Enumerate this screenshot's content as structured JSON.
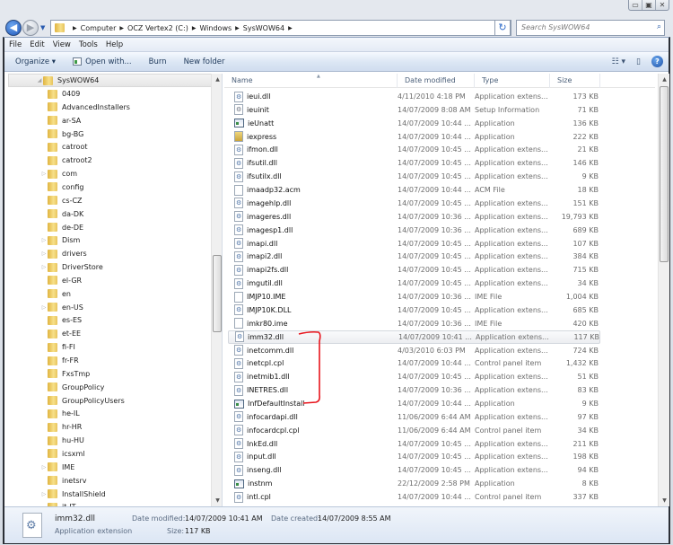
{
  "window_controls": {
    "minimize": "▭",
    "maximize": "▣",
    "close": "✕"
  },
  "address": {
    "crumbs": [
      "Computer",
      "OCZ Vertex2 (C:)",
      "Windows",
      "SysWOW64"
    ],
    "search_placeholder": "Search SysWOW64"
  },
  "menu": [
    "File",
    "Edit",
    "View",
    "Tools",
    "Help"
  ],
  "toolbar": {
    "organize": "Organize ▾",
    "open_with": "Open with...",
    "burn": "Burn",
    "new_folder": "New folder",
    "views": "☷ ▾",
    "preview": "▯",
    "help": "?"
  },
  "tree": {
    "selected": "SysWOW64",
    "items": [
      {
        "label": "0409",
        "exp": false
      },
      {
        "label": "AdvancedInstallers",
        "exp": false
      },
      {
        "label": "ar-SA",
        "exp": false
      },
      {
        "label": "bg-BG",
        "exp": false
      },
      {
        "label": "catroot",
        "exp": false
      },
      {
        "label": "catroot2",
        "exp": false
      },
      {
        "label": "com",
        "exp": true
      },
      {
        "label": "config",
        "exp": false
      },
      {
        "label": "cs-CZ",
        "exp": false
      },
      {
        "label": "da-DK",
        "exp": false
      },
      {
        "label": "de-DE",
        "exp": false
      },
      {
        "label": "Dism",
        "exp": true
      },
      {
        "label": "drivers",
        "exp": true
      },
      {
        "label": "DriverStore",
        "exp": true
      },
      {
        "label": "el-GR",
        "exp": false
      },
      {
        "label": "en",
        "exp": false
      },
      {
        "label": "en-US",
        "exp": true
      },
      {
        "label": "es-ES",
        "exp": false
      },
      {
        "label": "et-EE",
        "exp": false
      },
      {
        "label": "fi-FI",
        "exp": false
      },
      {
        "label": "fr-FR",
        "exp": false
      },
      {
        "label": "FxsTmp",
        "exp": false
      },
      {
        "label": "GroupPolicy",
        "exp": false
      },
      {
        "label": "GroupPolicyUsers",
        "exp": false
      },
      {
        "label": "he-IL",
        "exp": false
      },
      {
        "label": "hr-HR",
        "exp": false
      },
      {
        "label": "hu-HU",
        "exp": false
      },
      {
        "label": "icsxml",
        "exp": false
      },
      {
        "label": "IME",
        "exp": true
      },
      {
        "label": "inetsrv",
        "exp": false
      },
      {
        "label": "InstallShield",
        "exp": true
      },
      {
        "label": "it-IT",
        "exp": false
      }
    ]
  },
  "columns": {
    "name": "Name",
    "date": "Date modified",
    "type": "Type",
    "size": "Size"
  },
  "files": [
    {
      "name": "ieui.dll",
      "date": "4/11/2010 4:18 PM",
      "type": "Application extens...",
      "size": "173 KB",
      "icon": "dll"
    },
    {
      "name": "ieuinit",
      "date": "14/07/2009 8:08 AM",
      "type": "Setup Information",
      "size": "71 KB",
      "icon": "setup"
    },
    {
      "name": "ieUnatt",
      "date": "14/07/2009 10:44 ...",
      "type": "Application",
      "size": "136 KB",
      "icon": "app"
    },
    {
      "name": "iexpress",
      "date": "14/07/2009 10:44 ...",
      "type": "Application",
      "size": "222 KB",
      "icon": "express"
    },
    {
      "name": "ifmon.dll",
      "date": "14/07/2009 10:45 ...",
      "type": "Application extens...",
      "size": "21 KB",
      "icon": "dll"
    },
    {
      "name": "ifsutil.dll",
      "date": "14/07/2009 10:45 ...",
      "type": "Application extens...",
      "size": "146 KB",
      "icon": "dll"
    },
    {
      "name": "ifsutilx.dll",
      "date": "14/07/2009 10:45 ...",
      "type": "Application extens...",
      "size": "9 KB",
      "icon": "dll"
    },
    {
      "name": "imaadp32.acm",
      "date": "14/07/2009 10:44 ...",
      "type": "ACM File",
      "size": "18 KB",
      "icon": "file"
    },
    {
      "name": "imagehlp.dll",
      "date": "14/07/2009 10:45 ...",
      "type": "Application extens...",
      "size": "151 KB",
      "icon": "dll"
    },
    {
      "name": "imageres.dll",
      "date": "14/07/2009 10:36 ...",
      "type": "Application extens...",
      "size": "19,793 KB",
      "icon": "dll"
    },
    {
      "name": "imagesp1.dll",
      "date": "14/07/2009 10:36 ...",
      "type": "Application extens...",
      "size": "689 KB",
      "icon": "dll"
    },
    {
      "name": "imapi.dll",
      "date": "14/07/2009 10:45 ...",
      "type": "Application extens...",
      "size": "107 KB",
      "icon": "dll"
    },
    {
      "name": "imapi2.dll",
      "date": "14/07/2009 10:45 ...",
      "type": "Application extens...",
      "size": "384 KB",
      "icon": "dll"
    },
    {
      "name": "imapi2fs.dll",
      "date": "14/07/2009 10:45 ...",
      "type": "Application extens...",
      "size": "715 KB",
      "icon": "dll"
    },
    {
      "name": "imgutil.dll",
      "date": "14/07/2009 10:45 ...",
      "type": "Application extens...",
      "size": "34 KB",
      "icon": "dll"
    },
    {
      "name": "IMJP10.IME",
      "date": "14/07/2009 10:36 ...",
      "type": "IME File",
      "size": "1,004 KB",
      "icon": "file"
    },
    {
      "name": "IMJP10K.DLL",
      "date": "14/07/2009 10:45 ...",
      "type": "Application extens...",
      "size": "685 KB",
      "icon": "dll"
    },
    {
      "name": "imkr80.ime",
      "date": "14/07/2009 10:36 ...",
      "type": "IME File",
      "size": "420 KB",
      "icon": "file"
    },
    {
      "name": "imm32.dll",
      "date": "14/07/2009 10:41 ...",
      "type": "Application extens...",
      "size": "117 KB",
      "icon": "dll",
      "selected": true
    },
    {
      "name": "inetcomm.dll",
      "date": "4/03/2010 6:03 PM",
      "type": "Application extens...",
      "size": "724 KB",
      "icon": "dll"
    },
    {
      "name": "inetcpl.cpl",
      "date": "14/07/2009 10:44 ...",
      "type": "Control panel item",
      "size": "1,432 KB",
      "icon": "dll"
    },
    {
      "name": "inetmib1.dll",
      "date": "14/07/2009 10:45 ...",
      "type": "Application extens...",
      "size": "51 KB",
      "icon": "dll"
    },
    {
      "name": "INETRES.dll",
      "date": "14/07/2009 10:36 ...",
      "type": "Application extens...",
      "size": "83 KB",
      "icon": "dll"
    },
    {
      "name": "InfDefaultInstall",
      "date": "14/07/2009 10:44 ...",
      "type": "Application",
      "size": "9 KB",
      "icon": "app"
    },
    {
      "name": "infocardapi.dll",
      "date": "11/06/2009 6:44 AM",
      "type": "Application extens...",
      "size": "97 KB",
      "icon": "dll"
    },
    {
      "name": "infocardcpl.cpl",
      "date": "11/06/2009 6:44 AM",
      "type": "Control panel item",
      "size": "34 KB",
      "icon": "dll"
    },
    {
      "name": "InkEd.dll",
      "date": "14/07/2009 10:45 ...",
      "type": "Application extens...",
      "size": "211 KB",
      "icon": "dll"
    },
    {
      "name": "input.dll",
      "date": "14/07/2009 10:45 ...",
      "type": "Application extens...",
      "size": "198 KB",
      "icon": "dll"
    },
    {
      "name": "inseng.dll",
      "date": "14/07/2009 10:45 ...",
      "type": "Application extens...",
      "size": "94 KB",
      "icon": "dll"
    },
    {
      "name": "instnm",
      "date": "22/12/2009 2:58 PM",
      "type": "Application",
      "size": "8 KB",
      "icon": "app"
    },
    {
      "name": "intl.cpl",
      "date": "14/07/2009 10:44 ...",
      "type": "Control panel item",
      "size": "337 KB",
      "icon": "dll"
    }
  ],
  "details": {
    "name": "imm32.dll",
    "type": "Application extension",
    "date_modified_label": "Date modified:",
    "date_modified": "14/07/2009 10:41 AM",
    "date_created_label": "Date created:",
    "date_created": "14/07/2009 8:55 AM",
    "size_label": "Size:",
    "size": "117 KB"
  },
  "annotation_color": "#e8141c"
}
